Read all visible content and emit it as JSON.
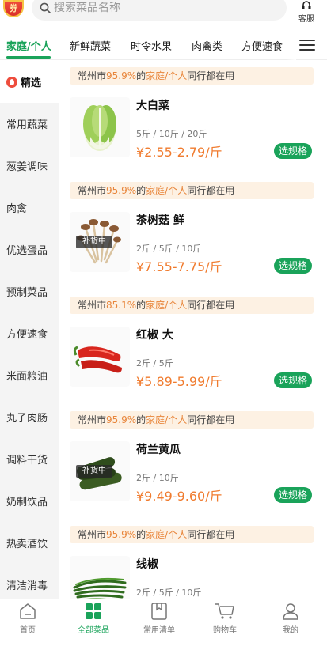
{
  "header": {
    "coupon_label": "券",
    "search_placeholder": "搜索菜品名称",
    "service_label": "客服"
  },
  "tabs": [
    {
      "label": "家庭/个人",
      "active": true
    },
    {
      "label": "新鲜蔬菜",
      "active": false
    },
    {
      "label": "时令水果",
      "active": false
    },
    {
      "label": "肉禽类",
      "active": false
    },
    {
      "label": "方便速食",
      "active": false
    }
  ],
  "sidebar": {
    "items": [
      {
        "label": "精选",
        "selected": true
      },
      {
        "label": "常用蔬菜"
      },
      {
        "label": "葱姜调味"
      },
      {
        "label": "肉禽"
      },
      {
        "label": "优选蛋品"
      },
      {
        "label": "预制菜品"
      },
      {
        "label": "方便速食"
      },
      {
        "label": "米面粮油"
      },
      {
        "label": "丸子肉肠"
      },
      {
        "label": "调料干货"
      },
      {
        "label": "奶制饮品"
      },
      {
        "label": "热卖酒饮"
      },
      {
        "label": "清洁消毒"
      }
    ]
  },
  "peer_text": {
    "city": "常州市",
    "segment": "家庭/个人",
    "suffix": "同行都在用",
    "de": "的"
  },
  "products": [
    {
      "name": "大白菜",
      "specs": "5斤 / 10斤 / 20斤",
      "price": "¥2.55-2.79/斤",
      "peer_percent": "95.9%",
      "restock": "",
      "button": "选规格",
      "image": "napa-cabbage"
    },
    {
      "name": "茶树菇 鲜",
      "specs": "2斤 / 5斤 / 10斤",
      "price": "¥7.55-7.75/斤",
      "peer_percent": "95.9%",
      "restock": "补货中",
      "button": "选规格",
      "image": "tea-tree-mushroom"
    },
    {
      "name": "红椒 大",
      "specs": "2斤 / 5斤",
      "price": "¥5.89-5.99/斤",
      "peer_percent": "85.1%",
      "restock": "",
      "button": "选规格",
      "image": "red-pepper"
    },
    {
      "name": "荷兰黄瓜",
      "specs": "2斤 / 10斤",
      "price": "¥9.49-9.60/斤",
      "peer_percent": "95.9%",
      "restock": "补货中",
      "button": "选规格",
      "image": "mini-cucumber"
    },
    {
      "name": "线椒",
      "specs": "2斤 / 5斤 / 10斤",
      "price": "",
      "peer_percent": "95.9%",
      "restock": "",
      "button": "",
      "image": "green-chili"
    }
  ],
  "bottom_nav": [
    {
      "label": "首页",
      "icon": "home-icon",
      "active": false
    },
    {
      "label": "全部菜品",
      "icon": "grid-icon",
      "active": true
    },
    {
      "label": "常用清单",
      "icon": "bookmark-list-icon",
      "active": false
    },
    {
      "label": "购物车",
      "icon": "cart-icon",
      "active": false
    },
    {
      "label": "我的",
      "icon": "user-icon",
      "active": false
    }
  ],
  "colors": {
    "accent": "#1aa35a",
    "price": "#f07b2e",
    "peer_bg": "#fdf1e3",
    "peer_highlight": "#e8853a"
  }
}
